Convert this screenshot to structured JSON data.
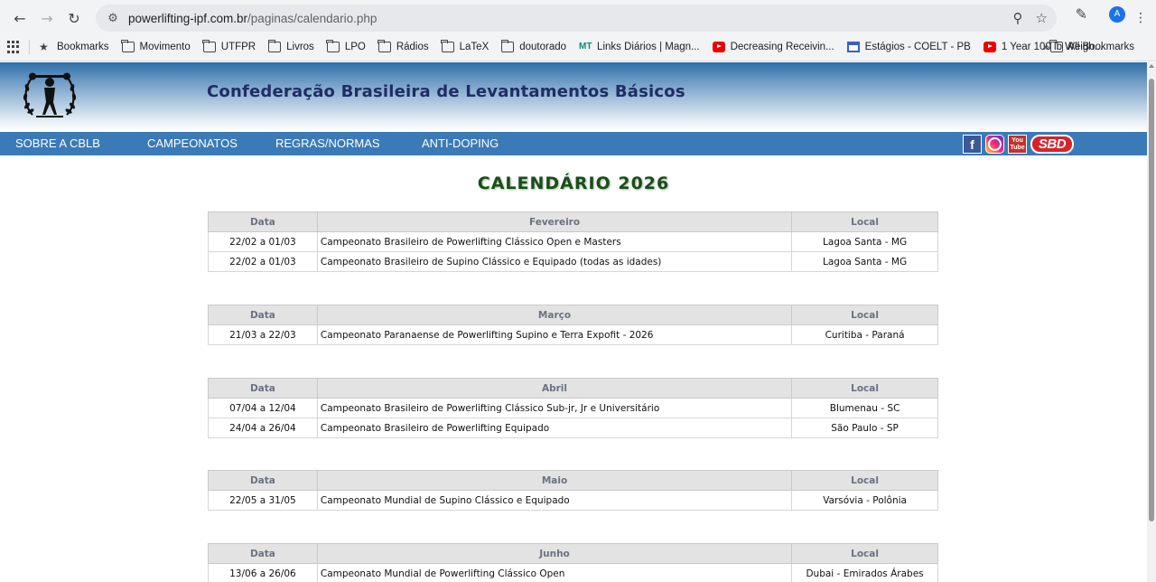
{
  "browser": {
    "url_host": "powerlifting-ipf.com.br",
    "url_path": "/paginas/calendario.php",
    "avatar_letter": "A",
    "bookmarks": [
      {
        "label": "Bookmarks",
        "icon": "star-icon"
      },
      {
        "label": "Movimento",
        "icon": "folder-icon"
      },
      {
        "label": "UTFPR",
        "icon": "folder-icon"
      },
      {
        "label": "Livros",
        "icon": "folder-icon"
      },
      {
        "label": "LPO",
        "icon": "folder-icon"
      },
      {
        "label": "Rádios",
        "icon": "folder-icon"
      },
      {
        "label": "LaTeX",
        "icon": "folder-icon"
      },
      {
        "label": "doutorado",
        "icon": "folder-icon"
      },
      {
        "label": "Links Diários | Magn...",
        "icon": "mt-icon",
        "icon_text": "MT"
      },
      {
        "label": "Decreasing Receivin...",
        "icon": "youtube-icon"
      },
      {
        "label": "Estágios - COELT - PB",
        "icon": "calendar-icon"
      },
      {
        "label": "1 Year 100 lb Weigh...",
        "icon": "youtube-icon"
      }
    ],
    "all_bookmarks": "All Bookmarks"
  },
  "site": {
    "title": "Confederação Brasileira de Levantamentos Básicos",
    "menu": [
      "SOBRE A CBLB",
      "CAMPEONATOS",
      "REGRAS/NORMAS",
      "ANTI-DOPING"
    ],
    "social": {
      "facebook": "f",
      "youtube_top": "You",
      "youtube_bottom": "Tube",
      "sbd": "SBD"
    }
  },
  "calendar": {
    "title": "CALENDÁRIO 2026",
    "headers": {
      "date": "Data",
      "local": "Local"
    },
    "months": [
      {
        "name": "Fevereiro",
        "events": [
          {
            "date": "22/02 a 01/03",
            "name": "Campeonato Brasileiro de Powerlifting Clássico Open e Masters",
            "local": "Lagoa Santa - MG"
          },
          {
            "date": "22/02 a 01/03",
            "name": "Campeonato Brasileiro de Supino Clássico e Equipado (todas as idades)",
            "local": "Lagoa Santa - MG"
          }
        ]
      },
      {
        "name": "Março",
        "events": [
          {
            "date": "21/03 a 22/03",
            "name": "Campeonato Paranaense de Powerlifting Supino e Terra Expofit - 2026",
            "local": "Curitiba - Paraná"
          }
        ]
      },
      {
        "name": "Abril",
        "events": [
          {
            "date": "07/04 a 12/04",
            "name": "Campeonato Brasileiro de Powerlifting Clássico Sub-jr, Jr e Universitário",
            "local": "Blumenau - SC"
          },
          {
            "date": "24/04 a 26/04",
            "name": "Campeonato Brasileiro de Powerlifting Equipado",
            "local": "São Paulo - SP"
          }
        ]
      },
      {
        "name": "Maio",
        "events": [
          {
            "date": "22/05 a 31/05",
            "name": "Campeonato Mundial de Supino Clássico e Equipado",
            "local": "Varsóvia - Polônia"
          }
        ]
      },
      {
        "name": "Junho",
        "events": [
          {
            "date": "13/06 a 26/06",
            "name": "Campeonato Mundial de Powerlifting Clássico Open",
            "local": "Dubai - Emirados Árabes"
          }
        ]
      }
    ]
  }
}
